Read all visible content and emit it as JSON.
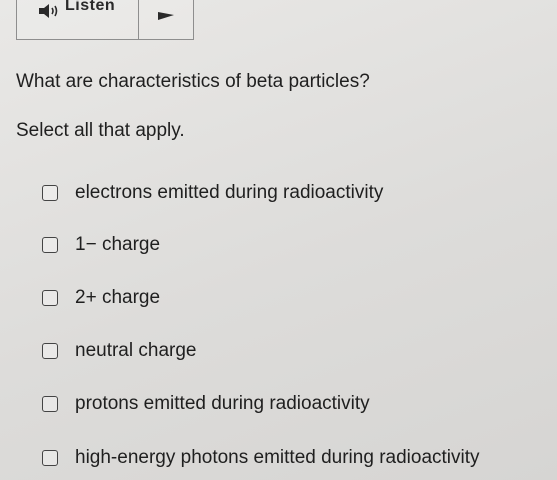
{
  "toolbar": {
    "listen_label": "Listen"
  },
  "question": {
    "text": "What are characteristics of beta particles?",
    "instruction": "Select all that apply."
  },
  "options": [
    {
      "label": "electrons emitted during radioactivity",
      "checked": false
    },
    {
      "label": "1− charge",
      "checked": false
    },
    {
      "label": "2+ charge",
      "checked": false
    },
    {
      "label": "neutral charge",
      "checked": false
    },
    {
      "label": "protons emitted during radioactivity",
      "checked": false
    },
    {
      "label": "high-energy photons emitted during radioactivity",
      "checked": false
    }
  ],
  "icons": {
    "listen": "speaker-icon",
    "dropdown": "play-triangle-icon"
  }
}
